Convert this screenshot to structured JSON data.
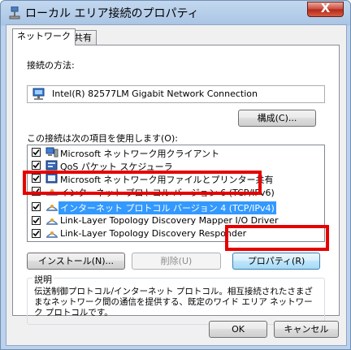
{
  "window": {
    "title": "ローカル エリア接続のプロパティ",
    "close_label": "X"
  },
  "tabs": [
    {
      "label": "ネットワーク",
      "active": true
    },
    {
      "label": "共有",
      "active": false
    }
  ],
  "connect_using": {
    "label": "接続の方法:",
    "adapter": "Intel(R) 82577LM Gigabit Network Connection",
    "configure_button": "構成(C)..."
  },
  "items_section": {
    "label": "この接続は次の項目を使用します(O):",
    "items": [
      {
        "label": "Microsoft ネットワーク用クライアント",
        "checked": true,
        "icon": "network-client-icon"
      },
      {
        "label": "QoS パケット スケジューラ",
        "checked": true,
        "icon": "qos-scheduler-icon"
      },
      {
        "label": "Microsoft ネットワーク用ファイルとプリンター共有",
        "checked": true,
        "icon": "file-printer-sharing-icon"
      },
      {
        "label": "インターネット プロトコル バージョン 6 (TCP/IPv6)",
        "checked": true,
        "icon": "protocol-icon"
      },
      {
        "label": "インターネット プロトコル バージョン 4 (TCP/IPv4)",
        "checked": true,
        "icon": "protocol-icon",
        "selected": true
      },
      {
        "label": "Link-Layer Topology Discovery Mapper I/O Driver",
        "checked": true,
        "icon": "protocol-icon"
      },
      {
        "label": "Link-Layer Topology Discovery Responder",
        "checked": true,
        "icon": "protocol-icon"
      }
    ]
  },
  "actions": {
    "install": "インストール(N)...",
    "uninstall": "削除(U)",
    "properties": "プロパティ(R)"
  },
  "description": {
    "title": "説明",
    "text": "伝送制御プロトコル/インターネット プロトコル。相互接続されたさまざまなネットワーク間の通信を提供する、既定のワイド エリア ネットワーク プロトコルです。"
  },
  "footer": {
    "ok": "OK",
    "cancel": "キャンセル"
  },
  "colors": {
    "selection": "#3399ff",
    "highlight": "#e60000"
  }
}
